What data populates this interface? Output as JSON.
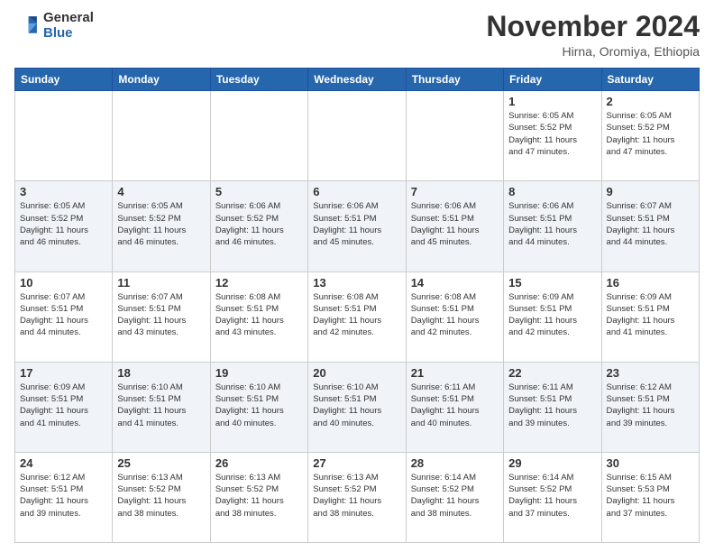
{
  "header": {
    "logo": {
      "general": "General",
      "blue": "Blue"
    },
    "title": "November 2024",
    "location": "Hirna, Oromiya, Ethiopia"
  },
  "weekdays": [
    "Sunday",
    "Monday",
    "Tuesday",
    "Wednesday",
    "Thursday",
    "Friday",
    "Saturday"
  ],
  "weeks": [
    [
      {
        "day": "",
        "info": ""
      },
      {
        "day": "",
        "info": ""
      },
      {
        "day": "",
        "info": ""
      },
      {
        "day": "",
        "info": ""
      },
      {
        "day": "",
        "info": ""
      },
      {
        "day": "1",
        "info": "Sunrise: 6:05 AM\nSunset: 5:52 PM\nDaylight: 11 hours\nand 47 minutes."
      },
      {
        "day": "2",
        "info": "Sunrise: 6:05 AM\nSunset: 5:52 PM\nDaylight: 11 hours\nand 47 minutes."
      }
    ],
    [
      {
        "day": "3",
        "info": "Sunrise: 6:05 AM\nSunset: 5:52 PM\nDaylight: 11 hours\nand 46 minutes."
      },
      {
        "day": "4",
        "info": "Sunrise: 6:05 AM\nSunset: 5:52 PM\nDaylight: 11 hours\nand 46 minutes."
      },
      {
        "day": "5",
        "info": "Sunrise: 6:06 AM\nSunset: 5:52 PM\nDaylight: 11 hours\nand 46 minutes."
      },
      {
        "day": "6",
        "info": "Sunrise: 6:06 AM\nSunset: 5:51 PM\nDaylight: 11 hours\nand 45 minutes."
      },
      {
        "day": "7",
        "info": "Sunrise: 6:06 AM\nSunset: 5:51 PM\nDaylight: 11 hours\nand 45 minutes."
      },
      {
        "day": "8",
        "info": "Sunrise: 6:06 AM\nSunset: 5:51 PM\nDaylight: 11 hours\nand 44 minutes."
      },
      {
        "day": "9",
        "info": "Sunrise: 6:07 AM\nSunset: 5:51 PM\nDaylight: 11 hours\nand 44 minutes."
      }
    ],
    [
      {
        "day": "10",
        "info": "Sunrise: 6:07 AM\nSunset: 5:51 PM\nDaylight: 11 hours\nand 44 minutes."
      },
      {
        "day": "11",
        "info": "Sunrise: 6:07 AM\nSunset: 5:51 PM\nDaylight: 11 hours\nand 43 minutes."
      },
      {
        "day": "12",
        "info": "Sunrise: 6:08 AM\nSunset: 5:51 PM\nDaylight: 11 hours\nand 43 minutes."
      },
      {
        "day": "13",
        "info": "Sunrise: 6:08 AM\nSunset: 5:51 PM\nDaylight: 11 hours\nand 42 minutes."
      },
      {
        "day": "14",
        "info": "Sunrise: 6:08 AM\nSunset: 5:51 PM\nDaylight: 11 hours\nand 42 minutes."
      },
      {
        "day": "15",
        "info": "Sunrise: 6:09 AM\nSunset: 5:51 PM\nDaylight: 11 hours\nand 42 minutes."
      },
      {
        "day": "16",
        "info": "Sunrise: 6:09 AM\nSunset: 5:51 PM\nDaylight: 11 hours\nand 41 minutes."
      }
    ],
    [
      {
        "day": "17",
        "info": "Sunrise: 6:09 AM\nSunset: 5:51 PM\nDaylight: 11 hours\nand 41 minutes."
      },
      {
        "day": "18",
        "info": "Sunrise: 6:10 AM\nSunset: 5:51 PM\nDaylight: 11 hours\nand 41 minutes."
      },
      {
        "day": "19",
        "info": "Sunrise: 6:10 AM\nSunset: 5:51 PM\nDaylight: 11 hours\nand 40 minutes."
      },
      {
        "day": "20",
        "info": "Sunrise: 6:10 AM\nSunset: 5:51 PM\nDaylight: 11 hours\nand 40 minutes."
      },
      {
        "day": "21",
        "info": "Sunrise: 6:11 AM\nSunset: 5:51 PM\nDaylight: 11 hours\nand 40 minutes."
      },
      {
        "day": "22",
        "info": "Sunrise: 6:11 AM\nSunset: 5:51 PM\nDaylight: 11 hours\nand 39 minutes."
      },
      {
        "day": "23",
        "info": "Sunrise: 6:12 AM\nSunset: 5:51 PM\nDaylight: 11 hours\nand 39 minutes."
      }
    ],
    [
      {
        "day": "24",
        "info": "Sunrise: 6:12 AM\nSunset: 5:51 PM\nDaylight: 11 hours\nand 39 minutes."
      },
      {
        "day": "25",
        "info": "Sunrise: 6:13 AM\nSunset: 5:52 PM\nDaylight: 11 hours\nand 38 minutes."
      },
      {
        "day": "26",
        "info": "Sunrise: 6:13 AM\nSunset: 5:52 PM\nDaylight: 11 hours\nand 38 minutes."
      },
      {
        "day": "27",
        "info": "Sunrise: 6:13 AM\nSunset: 5:52 PM\nDaylight: 11 hours\nand 38 minutes."
      },
      {
        "day": "28",
        "info": "Sunrise: 6:14 AM\nSunset: 5:52 PM\nDaylight: 11 hours\nand 38 minutes."
      },
      {
        "day": "29",
        "info": "Sunrise: 6:14 AM\nSunset: 5:52 PM\nDaylight: 11 hours\nand 37 minutes."
      },
      {
        "day": "30",
        "info": "Sunrise: 6:15 AM\nSunset: 5:53 PM\nDaylight: 11 hours\nand 37 minutes."
      }
    ]
  ]
}
